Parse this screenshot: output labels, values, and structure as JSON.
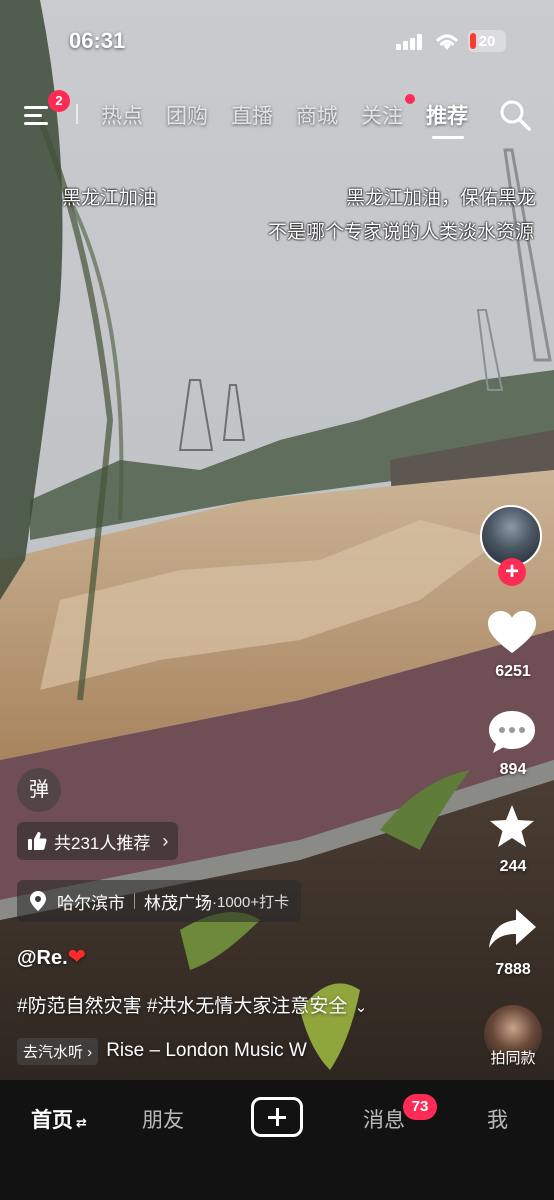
{
  "status_bar": {
    "time": "06:31",
    "battery": "20"
  },
  "top_nav": {
    "menu_badge": "2",
    "tabs": [
      {
        "label": "热点"
      },
      {
        "label": "团购"
      },
      {
        "label": "直播"
      },
      {
        "label": "商城"
      },
      {
        "label": "关注"
      },
      {
        "label": "推荐",
        "active": true
      }
    ]
  },
  "danmu": [
    "黑龙江加油",
    "黑龙江加油，保佑黑龙",
    "不是哪个专家说的人类淡水资源"
  ],
  "right_rail": {
    "likes": "6251",
    "comments": "894",
    "favorites": "244",
    "shares": "7888",
    "paitong_label": "拍同款"
  },
  "overlay": {
    "danmu_button": "弹",
    "recommend": "共231人推荐",
    "location_city": "哈尔滨市",
    "location_place": "林茂广场",
    "location_checkins": "·1000+打卡",
    "author": "@Re.",
    "caption": "#防范自然灾害 #洪水无情大家注意安全",
    "music_tag": "去汽水听",
    "music_title": "Rise – London Music W"
  },
  "bottom_nav": {
    "home": "首页",
    "friends": "朋友",
    "messages": "消息",
    "messages_badge": "73",
    "me": "我"
  },
  "colors": {
    "accent": "#fe2c55",
    "bottom_bar": "#121212"
  },
  "icons": [
    "menu-icon",
    "search-icon",
    "heart-icon",
    "comment-icon",
    "star-icon",
    "share-icon",
    "thumbs-up-icon",
    "location-pin-icon",
    "plus-icon"
  ]
}
